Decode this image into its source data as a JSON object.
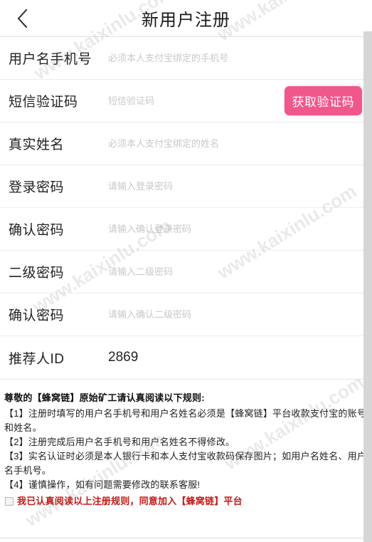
{
  "header": {
    "back_icon": "chevron-left-icon",
    "title": "新用户注册"
  },
  "form": {
    "rows": [
      {
        "label": "用户名手机号",
        "placeholder": "必须本人支付宝绑定的手机号",
        "value": ""
      },
      {
        "label": "短信验证码",
        "placeholder": "短信验证码",
        "value": "",
        "button_label": "获取验证码"
      },
      {
        "label": "真实姓名",
        "placeholder": "必须本人支付宝绑定的姓名",
        "value": ""
      },
      {
        "label": "登录密码",
        "placeholder": "请输入登录密码",
        "value": ""
      },
      {
        "label": "确认密码",
        "placeholder": "请输入确认登录密码",
        "value": ""
      },
      {
        "label": "二级密码",
        "placeholder": "请输入二级密码",
        "value": ""
      },
      {
        "label": "确认密码",
        "placeholder": "请输入确认二级密码",
        "value": ""
      },
      {
        "label": "推荐人ID",
        "placeholder": "",
        "value": "2869"
      }
    ]
  },
  "rules": {
    "title": "尊敬的【蜂窝链】原始矿工请认真阅读以下规则:",
    "items": [
      "【1】注册时填写的用户名手机号和用户名姓名必须是【蜂窝链】平台收款支付宝的账号和姓名。",
      "【2】注册完成后用户名手机号和用户名姓名不得修改。",
      "【3】实名认证时必须是本人银行卡和本人支付宝收款码保存图片；如用户名姓名、用户名手机号。",
      "【4】谨慎操作，如有问题需要修改的联系客服!"
    ],
    "agree_label": "我已认真阅读以上注册规则，同意加入【蜂窝链】平台",
    "agree_checked": false
  },
  "watermark": {
    "text": "www.kaixinlu.com"
  },
  "colors": {
    "accent_pink": "#f0578a",
    "agree_red": "#c21b17",
    "label_dark": "#222222",
    "placeholder_gray": "#c9c9c9",
    "divider": "#ededed",
    "scrollbar": "#d6d6d6"
  }
}
